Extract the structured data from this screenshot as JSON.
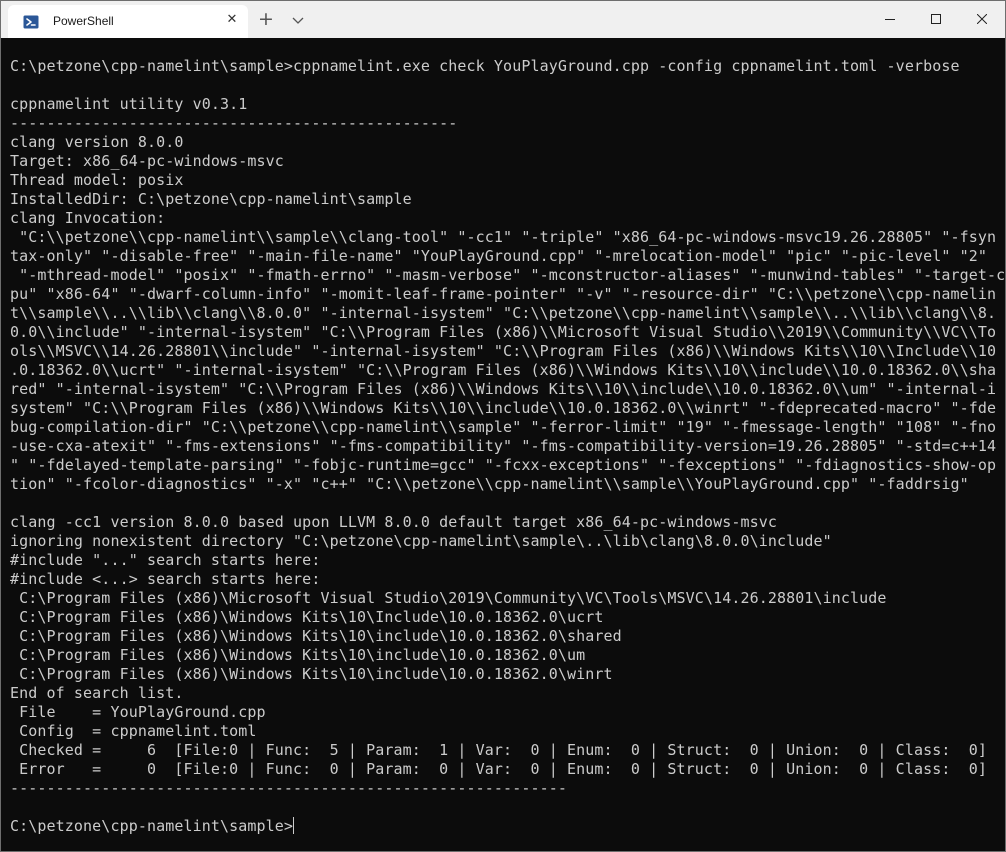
{
  "tab": {
    "title": "PowerShell",
    "icon": "powershell-icon",
    "close_glyph": "✕"
  },
  "titlebar": {
    "new_tab_glyph": "+",
    "dropdown_icon": "chevron-down-icon"
  },
  "window_controls": {
    "minimize": "minimize-icon",
    "maximize": "maximize-icon",
    "close": "close-icon"
  },
  "colors": {
    "terminal_bg": "#0c0c0c",
    "terminal_fg": "#cccccc",
    "titlebar_bg": "#f0f0f0",
    "tab_bg": "#ffffff",
    "powershell_blue": "#2b5797"
  },
  "terminal": {
    "prompt": "C:\\petzone\\cpp-namelint\\sample>",
    "lines": [
      "",
      "C:\\petzone\\cpp-namelint\\sample>cppnamelint.exe check YouPlayGround.cpp -config cppnamelint.toml -verbose",
      "",
      "cppnamelint utility v0.3.1",
      "-------------------------------------------------",
      "clang version 8.0.0",
      "Target: x86_64-pc-windows-msvc",
      "Thread model: posix",
      "InstalledDir: C:\\petzone\\cpp-namelint\\sample",
      "clang Invocation:",
      " \"C:\\\\petzone\\\\cpp-namelint\\\\sample\\\\clang-tool\" \"-cc1\" \"-triple\" \"x86_64-pc-windows-msvc19.26.28805\" \"-fsyn",
      "tax-only\" \"-disable-free\" \"-main-file-name\" \"YouPlayGround.cpp\" \"-mrelocation-model\" \"pic\" \"-pic-level\" \"2\"",
      " \"-mthread-model\" \"posix\" \"-fmath-errno\" \"-masm-verbose\" \"-mconstructor-aliases\" \"-munwind-tables\" \"-target-c",
      "pu\" \"x86-64\" \"-dwarf-column-info\" \"-momit-leaf-frame-pointer\" \"-v\" \"-resource-dir\" \"C:\\\\petzone\\\\cpp-namelin",
      "t\\\\sample\\\\..\\\\lib\\\\clang\\\\8.0.0\" \"-internal-isystem\" \"C:\\\\petzone\\\\cpp-namelint\\\\sample\\\\..\\\\lib\\\\clang\\\\8.",
      "0.0\\\\include\" \"-internal-isystem\" \"C:\\\\Program Files (x86)\\\\Microsoft Visual Studio\\\\2019\\\\Community\\\\VC\\\\To",
      "ols\\\\MSVC\\\\14.26.28801\\\\include\" \"-internal-isystem\" \"C:\\\\Program Files (x86)\\\\Windows Kits\\\\10\\\\Include\\\\10",
      ".0.18362.0\\\\ucrt\" \"-internal-isystem\" \"C:\\\\Program Files (x86)\\\\Windows Kits\\\\10\\\\include\\\\10.0.18362.0\\\\sha",
      "red\" \"-internal-isystem\" \"C:\\\\Program Files (x86)\\\\Windows Kits\\\\10\\\\include\\\\10.0.18362.0\\\\um\" \"-internal-i",
      "system\" \"C:\\\\Program Files (x86)\\\\Windows Kits\\\\10\\\\include\\\\10.0.18362.0\\\\winrt\" \"-fdeprecated-macro\" \"-fde",
      "bug-compilation-dir\" \"C:\\\\petzone\\\\cpp-namelint\\\\sample\" \"-ferror-limit\" \"19\" \"-fmessage-length\" \"108\" \"-fno",
      "-use-cxa-atexit\" \"-fms-extensions\" \"-fms-compatibility\" \"-fms-compatibility-version=19.26.28805\" \"-std=c++14",
      "\" \"-fdelayed-template-parsing\" \"-fobjc-runtime=gcc\" \"-fcxx-exceptions\" \"-fexceptions\" \"-fdiagnostics-show-op",
      "tion\" \"-fcolor-diagnostics\" \"-x\" \"c++\" \"C:\\\\petzone\\\\cpp-namelint\\\\sample\\\\YouPlayGround.cpp\" \"-faddrsig\"",
      "",
      "clang -cc1 version 8.0.0 based upon LLVM 8.0.0 default target x86_64-pc-windows-msvc",
      "ignoring nonexistent directory \"C:\\petzone\\cpp-namelint\\sample\\..\\lib\\clang\\8.0.0\\include\"",
      "#include \"...\" search starts here:",
      "#include <...> search starts here:",
      " C:\\Program Files (x86)\\Microsoft Visual Studio\\2019\\Community\\VC\\Tools\\MSVC\\14.26.28801\\include",
      " C:\\Program Files (x86)\\Windows Kits\\10\\Include\\10.0.18362.0\\ucrt",
      " C:\\Program Files (x86)\\Windows Kits\\10\\include\\10.0.18362.0\\shared",
      " C:\\Program Files (x86)\\Windows Kits\\10\\include\\10.0.18362.0\\um",
      " C:\\Program Files (x86)\\Windows Kits\\10\\include\\10.0.18362.0\\winrt",
      "End of search list.",
      " File    = YouPlayGround.cpp",
      " Config  = cppnamelint.toml",
      " Checked =     6  [File:0 | Func:  5 | Param:  1 | Var:  0 | Enum:  0 | Struct:  0 | Union:  0 | Class:  0]",
      " Error   =     0  [File:0 | Func:  0 | Param:  0 | Var:  0 | Enum:  0 | Struct:  0 | Union:  0 | Class:  0]",
      "-------------------------------------------------------------",
      ""
    ]
  }
}
